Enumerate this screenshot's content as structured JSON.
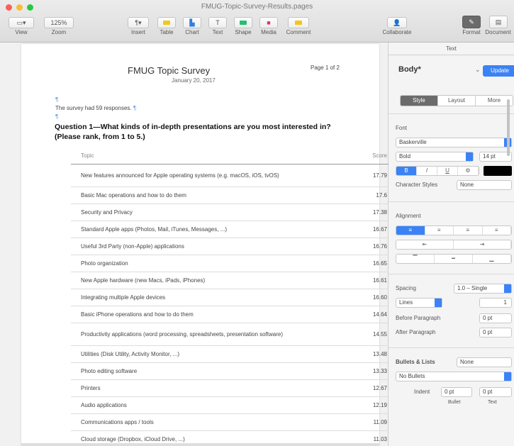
{
  "window": {
    "title": "FMUG-Topic-Survey-Results.pages",
    "traffic_colors": [
      "#fc5f57",
      "#fdbc2e",
      "#28c840"
    ]
  },
  "toolbar": {
    "view_label": "View",
    "zoom_value": "125%",
    "zoom_label": "Zoom",
    "insert_label": "Insert",
    "table_label": "Table",
    "chart_label": "Chart",
    "text_label": "Text",
    "shape_label": "Shape",
    "media_label": "Media",
    "comment_label": "Comment",
    "collaborate_label": "Collaborate",
    "format_label": "Format",
    "document_label": "Document"
  },
  "document": {
    "title": "FMUG Topic Survey",
    "date": "January 20, 2017",
    "page_number": "Page 1 of 2",
    "intro": "The survey had 59 responses.",
    "question": "Question 1—What kinds of in-depth presentations are you most interested in? (Please rank, from 1 to 5.)",
    "table": {
      "headers": [
        "Topic",
        "Score"
      ],
      "rows": [
        {
          "topic": "New features announced for Apple operating systems (e.g. macOS, iOS, tvOS)",
          "score": "17.79"
        },
        {
          "topic": "Basic Mac operations and how to do them",
          "score": "17.6"
        },
        {
          "topic": "Security and Privacy",
          "score": "17.38"
        },
        {
          "topic": "Standard Apple apps (Photos, Mail, iTunes, Messages, ...)",
          "score": "16.67"
        },
        {
          "topic": "Useful 3rd Party (non-Apple) applications",
          "score": "16.76"
        },
        {
          "topic": "Photo organization",
          "score": "16.65"
        },
        {
          "topic": "New Apple hardware (new Macs, iPads, iPhones)",
          "score": "16.61"
        },
        {
          "topic": "Integrating multiple Apple devices",
          "score": "16.60"
        },
        {
          "topic": "Basic iPhone operations and how to do them",
          "score": "14.64"
        },
        {
          "topic": "Productivity applications (word processing, spreadsheets, presentation software)",
          "score": "14.55"
        },
        {
          "topic": "Utilities (Disk Utility, Activity Monitor, ...)",
          "score": "13.48"
        },
        {
          "topic": "Photo editing software",
          "score": "13.33"
        },
        {
          "topic": "Printers",
          "score": "12.67"
        },
        {
          "topic": "Audio applications",
          "score": "12.19"
        },
        {
          "topic": "Communications apps / tools",
          "score": "11.09"
        },
        {
          "topic": "Cloud storage (Dropbox, iCloud Drive, ...)",
          "score": "11.03"
        }
      ]
    }
  },
  "inspector": {
    "top_tab": "Text",
    "paragraph_style": "Body*",
    "update_label": "Update",
    "tabs": [
      "Style",
      "Layout",
      "More"
    ],
    "font_section": "Font",
    "font_family": "Baskerville",
    "font_typeface": "Bold",
    "font_size": "14 pt",
    "char_style_label": "Character Styles",
    "char_style_value": "None",
    "alignment_label": "Alignment",
    "spacing_label": "Spacing",
    "spacing_value": "1.0 – Single",
    "lines_value": "Lines",
    "lines_num": "1",
    "before_label": "Before Paragraph",
    "before_value": "0 pt",
    "after_label": "After Paragraph",
    "after_value": "0 pt",
    "bullets_label": "Bullets & Lists",
    "bullets_value": "None",
    "bullet_type": "No Bullets",
    "indent_label": "Indent",
    "indent_bullet": "0 pt",
    "indent_text": "0 pt",
    "bullet_caption": "Bullet",
    "text_caption": "Text",
    "accent_color": "#3b82f6"
  }
}
